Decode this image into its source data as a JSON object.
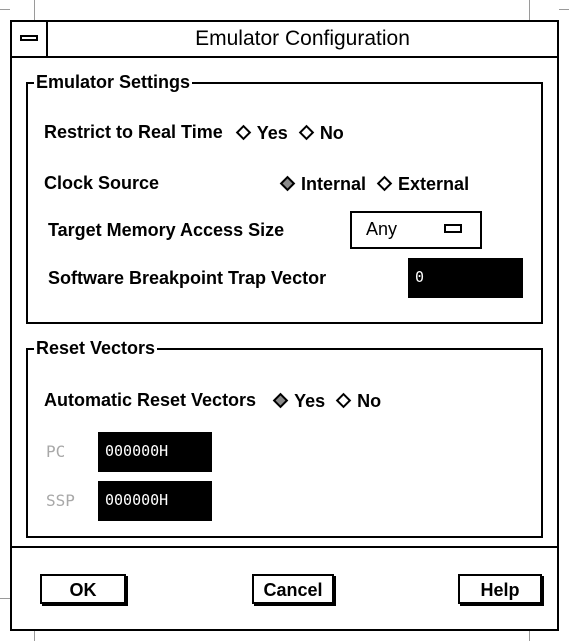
{
  "dialog": {
    "title": "Emulator Configuration"
  },
  "emulator_settings": {
    "label": "Emulator Settings",
    "restrict_real_time": {
      "label": "Restrict to Real Time",
      "yes": "Yes",
      "no": "No",
      "selected": "Yes"
    },
    "clock_source": {
      "label": "Clock Source",
      "internal": "Internal",
      "external": "External",
      "selected": "Internal"
    },
    "target_memory": {
      "label": "Target Memory Access Size",
      "value": "Any"
    },
    "sw_breakpoint": {
      "label": "Software Breakpoint Trap Vector",
      "value": "0"
    }
  },
  "reset_vectors": {
    "label": "Reset Vectors",
    "automatic": {
      "label": "Automatic Reset Vectors",
      "yes": "Yes",
      "no": "No",
      "selected": "Yes"
    },
    "pc": {
      "label": "PC",
      "value": "000000H"
    },
    "ssp": {
      "label": "SSP",
      "value": "000000H"
    }
  },
  "buttons": {
    "ok": "OK",
    "cancel": "Cancel",
    "help": "Help"
  }
}
